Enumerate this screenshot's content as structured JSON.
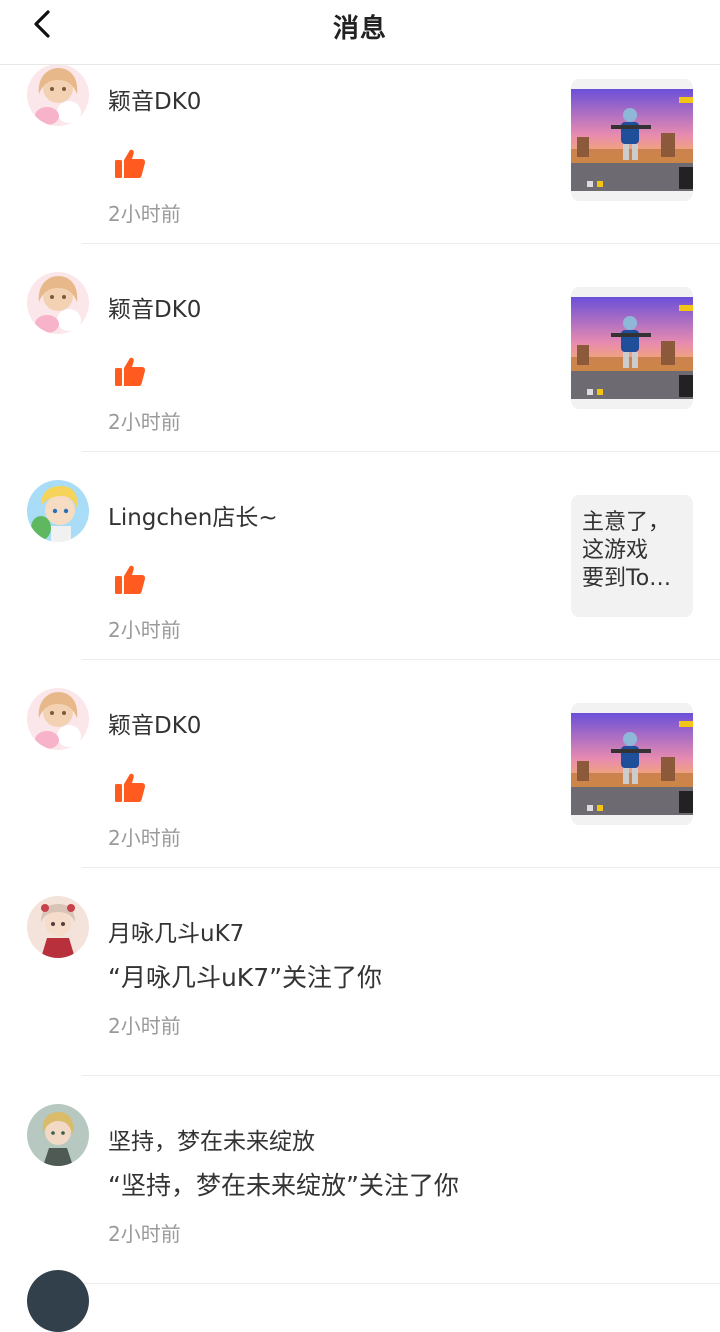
{
  "header": {
    "title": "消息",
    "back_icon": "chevron-left-icon"
  },
  "colors": {
    "like": "#ff5a1f",
    "name": "#333333",
    "time": "#9a9a9a",
    "divider": "#ececec"
  },
  "items": [
    {
      "type": "like",
      "user": "颖音DK0",
      "time": "2小时前",
      "avatar": "anime-girl-pink-avatar",
      "thumb": "game-screenshot"
    },
    {
      "type": "like",
      "user": "颖音DK0",
      "time": "2小时前",
      "avatar": "anime-girl-pink-avatar",
      "thumb": "game-screenshot"
    },
    {
      "type": "like",
      "user": "Lingchen店长~",
      "time": "2小时前",
      "avatar": "anime-boy-blue-avatar",
      "thumb_text": [
        "主意了，",
        "这游戏",
        "要到To…"
      ]
    },
    {
      "type": "like",
      "user": "颖音DK0",
      "time": "2小时前",
      "avatar": "anime-girl-pink-avatar",
      "thumb": "game-screenshot"
    },
    {
      "type": "follow",
      "user": "月咏几斗uK7",
      "message": "“月咏几斗uK7”关注了你",
      "time": "2小时前",
      "avatar": "anime-girl-red-avatar"
    },
    {
      "type": "follow",
      "user": "坚持，梦在未来绽放",
      "message": "“坚持，梦在未来绽放”关注了你",
      "time": "2小时前",
      "avatar": "anime-blonde-avatar"
    }
  ]
}
